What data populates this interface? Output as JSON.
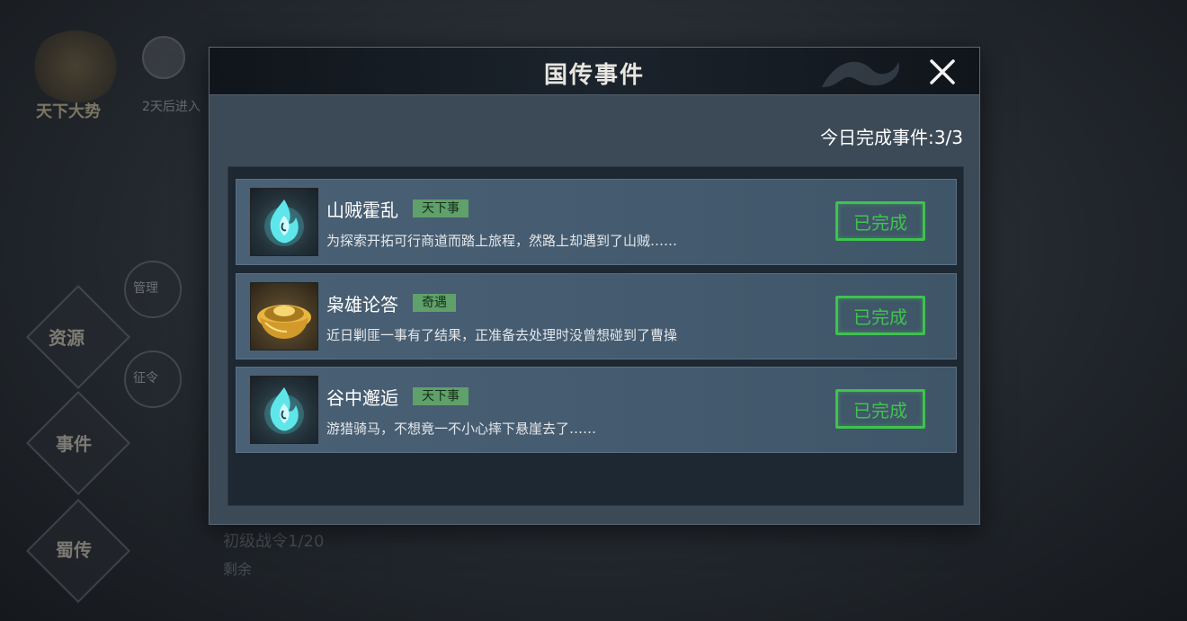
{
  "background": {
    "emblem_label": "天下大势",
    "subtext": "2天后进入",
    "menu_resource": "资源",
    "menu_event": "事件",
    "menu_shu": "蜀传",
    "menu_manage": "管理",
    "menu_levy": "征令",
    "faint_line1": "初级战令1/20",
    "faint_line2": "剩余"
  },
  "modal": {
    "title": "国传事件",
    "completed_label": "今日完成事件:",
    "completed_value": "3/3",
    "events": [
      {
        "icon": "blue-flame-icon",
        "title": "山贼霍乱",
        "tag": "天下事",
        "desc": "为探索开拓可行商道而踏上旅程，然路上却遇到了山贼……",
        "status": "已完成"
      },
      {
        "icon": "gold-ingot-icon",
        "title": "枭雄论答",
        "tag": "奇遇",
        "desc": "近日剿匪一事有了结果，正准备去处理时没曾想碰到了曹操",
        "status": "已完成"
      },
      {
        "icon": "blue-flame-icon",
        "title": "谷中邂逅",
        "tag": "天下事",
        "desc": "游猎骑马，不想竟一不小心摔下悬崖去了……",
        "status": "已完成"
      }
    ]
  },
  "colors": {
    "accent_green": "#3ec34d",
    "tag_green": "#5fa06b",
    "panel": "#3c4a57"
  }
}
